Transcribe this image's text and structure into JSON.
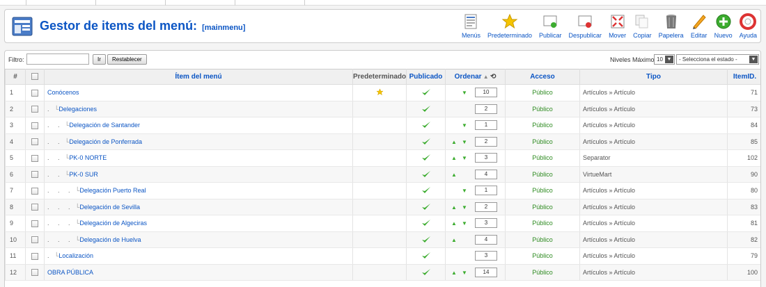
{
  "header": {
    "title": "Gestor de items del menú:",
    "subtitle": "[mainmenu]"
  },
  "toolbar": [
    {
      "label": "Menús",
      "icon": "menus-icon"
    },
    {
      "label": "Predeterminado",
      "icon": "default-star-icon"
    },
    {
      "label": "Publicar",
      "icon": "publish-icon"
    },
    {
      "label": "Despublicar",
      "icon": "unpublish-icon"
    },
    {
      "label": "Mover",
      "icon": "move-icon"
    },
    {
      "label": "Copiar",
      "icon": "copy-icon"
    },
    {
      "label": "Papelera",
      "icon": "trash-icon"
    },
    {
      "label": "Editar",
      "icon": "edit-icon"
    },
    {
      "label": "Nuevo",
      "icon": "new-icon"
    },
    {
      "label": "Ayuda",
      "icon": "help-icon"
    }
  ],
  "filter": {
    "label": "Filtro:",
    "value": "",
    "go_label": "Ir",
    "reset_label": "Restablecer",
    "levels_label": "Niveles Máximos",
    "levels_value": "10",
    "state_value": "- Selecciona el estado -"
  },
  "columns": {
    "num": "#",
    "item": "Ítem del menú",
    "default": "Predeterminado",
    "published": "Publicado",
    "order": "Ordenar",
    "access": "Acceso",
    "type": "Tipo",
    "itemid": "ItemID."
  },
  "rows": [
    {
      "num": "1",
      "level": 0,
      "name": "Conócenos",
      "default": true,
      "up": false,
      "down": true,
      "order": "10",
      "access": "Público",
      "type": "Artículos » Artículo",
      "id": "71"
    },
    {
      "num": "2",
      "level": 1,
      "name": "Delegaciones",
      "default": false,
      "up": false,
      "down": false,
      "order": "2",
      "access": "Público",
      "type": "Artículos » Artículo",
      "id": "73"
    },
    {
      "num": "3",
      "level": 2,
      "name": "Delegación de Santander",
      "default": false,
      "up": false,
      "down": true,
      "order": "1",
      "access": "Público",
      "type": "Artículos » Artículo",
      "id": "84"
    },
    {
      "num": "4",
      "level": 2,
      "name": "Delegación de Ponferrada",
      "default": false,
      "up": true,
      "down": true,
      "order": "2",
      "access": "Público",
      "type": "Artículos » Artículo",
      "id": "85"
    },
    {
      "num": "5",
      "level": 2,
      "name": "PK-0 NORTE",
      "default": false,
      "up": true,
      "down": true,
      "order": "3",
      "access": "Público",
      "type": "Separator",
      "id": "102"
    },
    {
      "num": "6",
      "level": 2,
      "name": "PK-0 SUR",
      "default": false,
      "up": true,
      "down": false,
      "order": "4",
      "access": "Público",
      "type": "VirtueMart",
      "id": "90"
    },
    {
      "num": "7",
      "level": 3,
      "name": "Delegación Puerto Real",
      "default": false,
      "up": false,
      "down": true,
      "order": "1",
      "access": "Público",
      "type": "Artículos » Artículo",
      "id": "80"
    },
    {
      "num": "8",
      "level": 3,
      "name": "Delegación de Sevilla",
      "default": false,
      "up": true,
      "down": true,
      "order": "2",
      "access": "Público",
      "type": "Artículos » Artículo",
      "id": "83"
    },
    {
      "num": "9",
      "level": 3,
      "name": "Delegación de Algeciras",
      "default": false,
      "up": true,
      "down": true,
      "order": "3",
      "access": "Público",
      "type": "Artículos » Artículo",
      "id": "81"
    },
    {
      "num": "10",
      "level": 3,
      "name": "Delegación de Huelva",
      "default": false,
      "up": true,
      "down": false,
      "order": "4",
      "access": "Público",
      "type": "Artículos » Artículo",
      "id": "82"
    },
    {
      "num": "11",
      "level": 1,
      "name": "Localización",
      "default": false,
      "up": false,
      "down": false,
      "order": "3",
      "access": "Público",
      "type": "Artículos » Artículo",
      "id": "79"
    },
    {
      "num": "12",
      "level": 0,
      "name": "OBRA PÚBLICA",
      "default": false,
      "up": true,
      "down": true,
      "order": "14",
      "access": "Público",
      "type": "Artículos » Artículo",
      "id": "100"
    }
  ]
}
